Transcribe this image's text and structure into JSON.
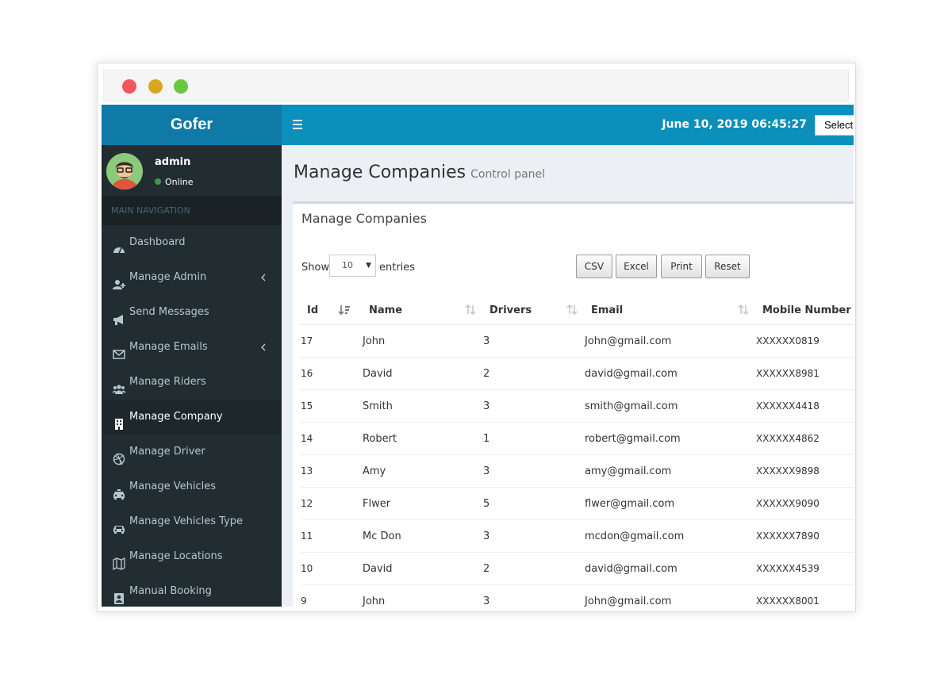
{
  "app": {
    "brand": "Gofer"
  },
  "user": {
    "name": "admin",
    "status": "Online"
  },
  "sidebar": {
    "header": "MAIN NAVIGATION",
    "items": [
      {
        "label": "Dashboard",
        "icon": "dashboard-icon",
        "expandable": false,
        "active": false
      },
      {
        "label": "Manage Admin",
        "icon": "user-plus-icon",
        "expandable": true,
        "active": false
      },
      {
        "label": "Send Messages",
        "icon": "bullhorn-icon",
        "expandable": false,
        "active": false
      },
      {
        "label": "Manage Emails",
        "icon": "envelope-icon",
        "expandable": true,
        "active": false
      },
      {
        "label": "Manage Riders",
        "icon": "users-icon",
        "expandable": false,
        "active": false
      },
      {
        "label": "Manage Company",
        "icon": "building-icon",
        "expandable": false,
        "active": true
      },
      {
        "label": "Manage Driver",
        "icon": "dribbble-icon",
        "expandable": false,
        "active": false
      },
      {
        "label": "Manage Vehicles",
        "icon": "taxi-icon",
        "expandable": false,
        "active": false
      },
      {
        "label": "Manage Vehicles Type",
        "icon": "car-icon",
        "expandable": false,
        "active": false
      },
      {
        "label": "Manage Locations",
        "icon": "map-icon",
        "expandable": false,
        "active": false
      },
      {
        "label": "Manual Booking",
        "icon": "address-book-icon",
        "expandable": false,
        "active": false
      }
    ]
  },
  "header": {
    "datetime": "June 10, 2019 06:45:27",
    "language_select": "Select"
  },
  "page": {
    "title": "Manage Companies",
    "subtitle": "Control panel"
  },
  "box": {
    "title": "Manage Companies",
    "show_label": "Show",
    "entries_value": "10",
    "entries_label": "entries",
    "buttons": [
      "CSV",
      "Excel",
      "Print",
      "Reset"
    ]
  },
  "table": {
    "columns": [
      "Id",
      "Name",
      "Drivers",
      "Email",
      "Mobile Number"
    ],
    "rows": [
      [
        "17",
        "John",
        "3",
        "John@gmail.com",
        "XXXXXX0819"
      ],
      [
        "16",
        "David",
        "2",
        "david@gmail.com",
        "XXXXXX8981"
      ],
      [
        "15",
        "Smith",
        "3",
        "smith@gmail.com",
        "XXXXXX4418"
      ],
      [
        "14",
        "Robert",
        "1",
        "robert@gmail.com",
        "XXXXXX4862"
      ],
      [
        "13",
        "Amy",
        "3",
        "amy@gmail.com",
        "XXXXXX9898"
      ],
      [
        "12",
        "Flwer",
        "5",
        "flwer@gmail.com",
        "XXXXXX9090"
      ],
      [
        "11",
        "Mc Don",
        "3",
        "mcdon@gmail.com",
        "XXXXXX7890"
      ],
      [
        "10",
        "David",
        "2",
        "david@gmail.com",
        "XXXXXX4539"
      ],
      [
        "9",
        "John",
        "3",
        "John@gmail.com",
        "XXXXXX8001"
      ]
    ]
  },
  "colors": {
    "brand": "#0f79a8",
    "topbar": "#0b8fbb",
    "sidebar_bg": "#222d32",
    "online": "#3c9a49"
  }
}
